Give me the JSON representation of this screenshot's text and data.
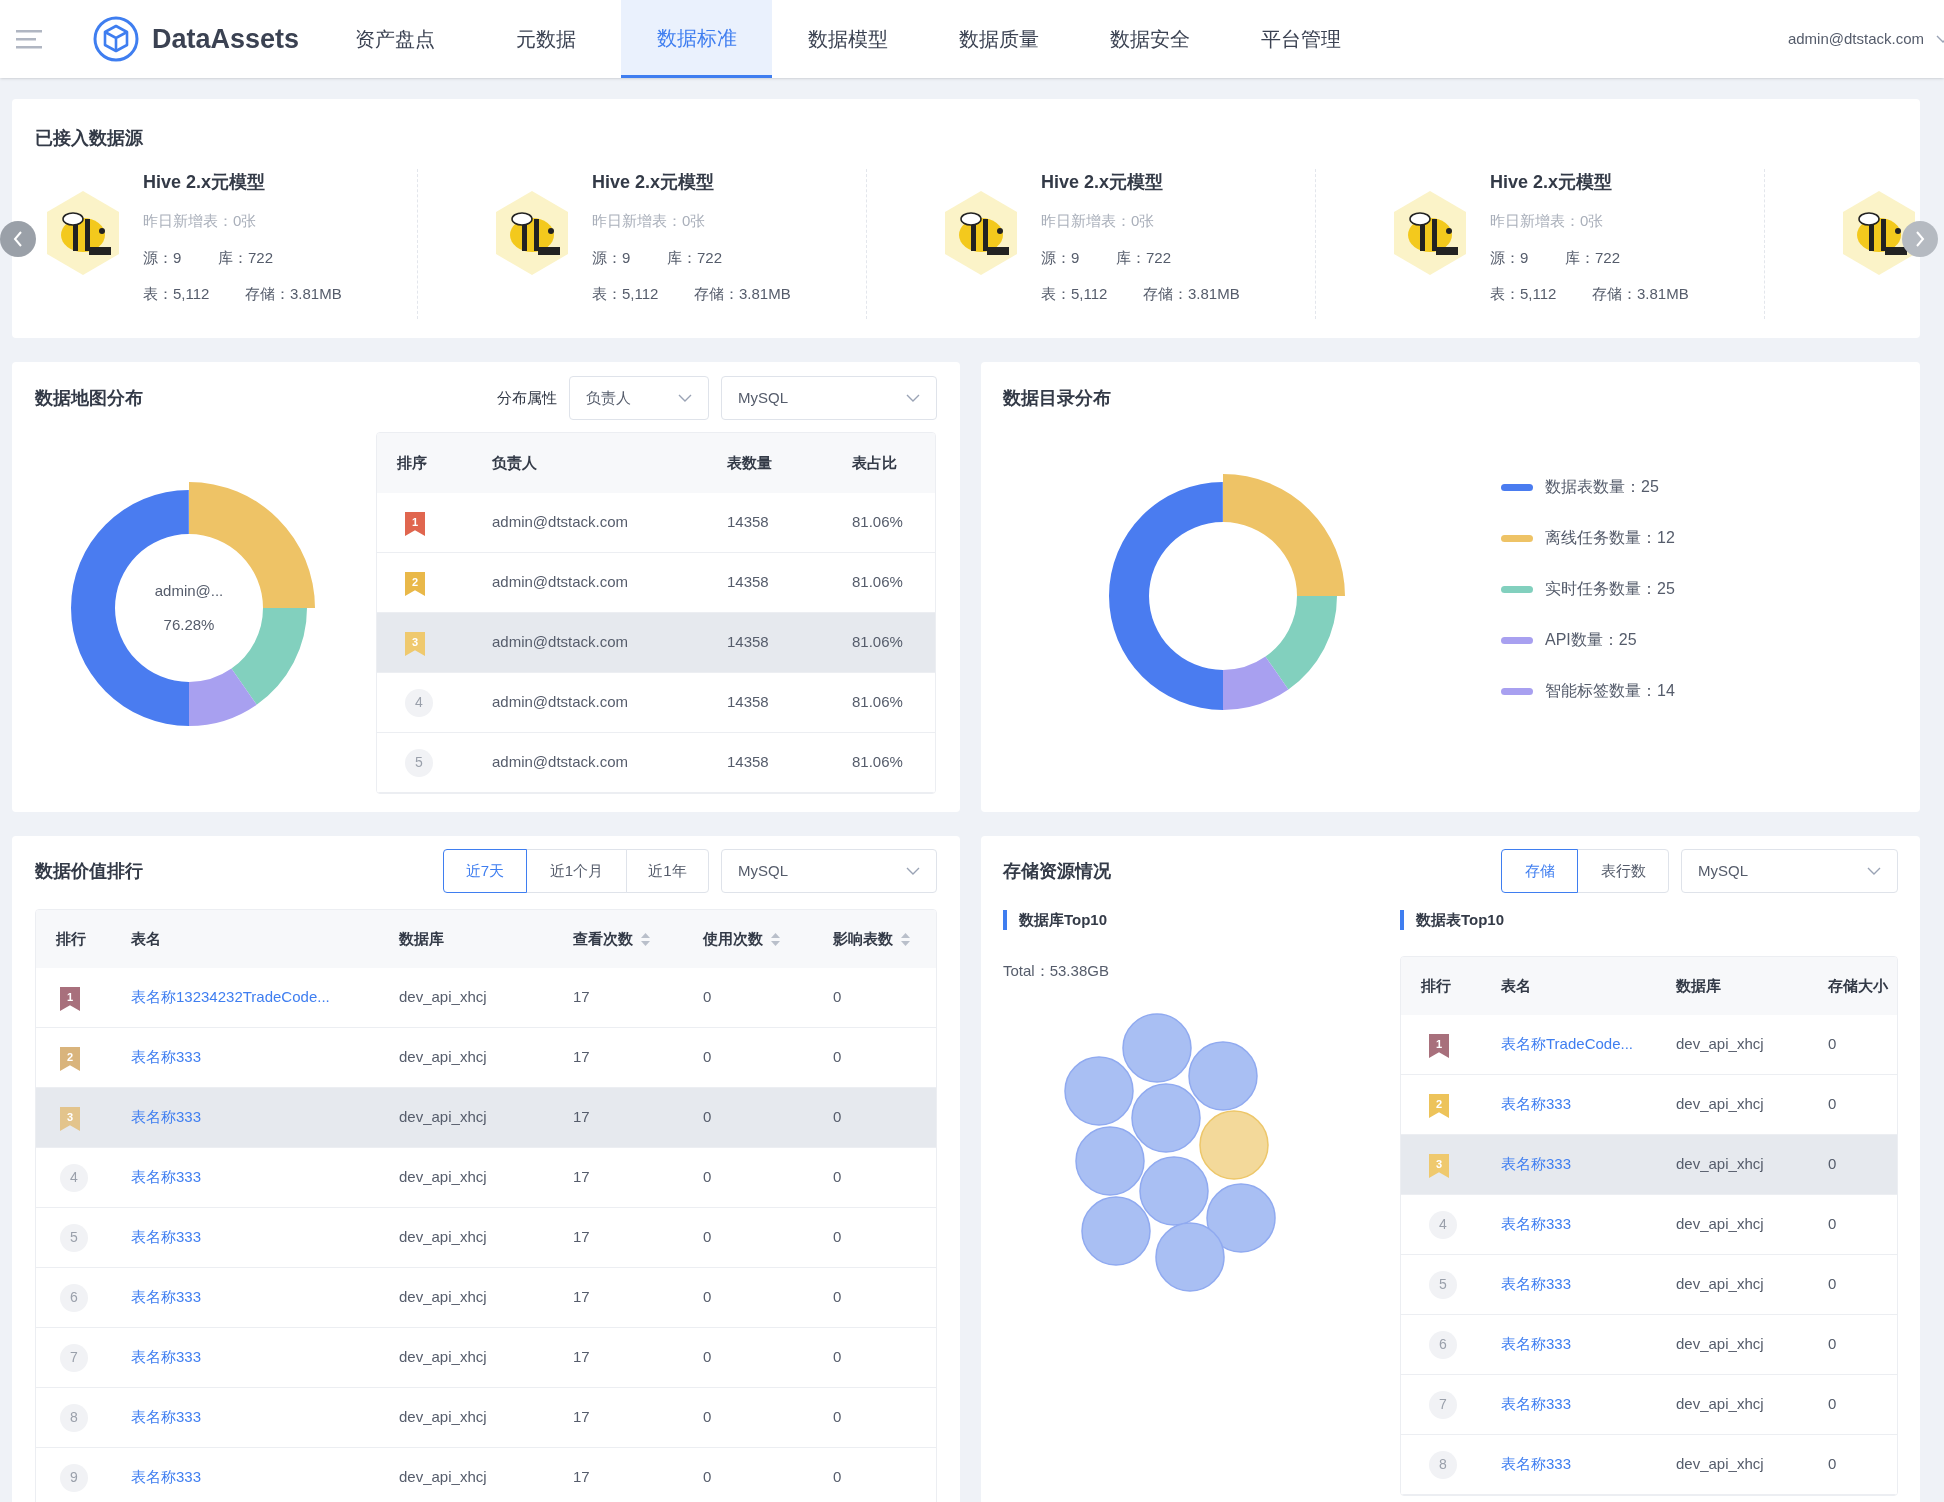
{
  "header": {
    "brand": "DataAssets",
    "nav": [
      {
        "label": "资产盘点",
        "selected": false
      },
      {
        "label": "元数据",
        "selected": false
      },
      {
        "label": "数据标准",
        "selected": true
      },
      {
        "label": "数据模型",
        "selected": false
      },
      {
        "label": "数据质量",
        "selected": false
      },
      {
        "label": "数据安全",
        "selected": false
      },
      {
        "label": "平台管理",
        "selected": false
      }
    ],
    "user": "admin@dtstack.com"
  },
  "sources": {
    "title": "已接入数据源",
    "next_peek": true,
    "items": [
      {
        "name": "Hive 2.x元模型",
        "new_tables": "昨日新增表：0张",
        "sources": "源：9",
        "databases": "库：722",
        "tables": "表：5,112",
        "storage": "存储：3.81MB"
      },
      {
        "name": "Hive 2.x元模型",
        "new_tables": "昨日新增表：0张",
        "sources": "源：9",
        "databases": "库：722",
        "tables": "表：5,112",
        "storage": "存储：3.81MB"
      },
      {
        "name": "Hive 2.x元模型",
        "new_tables": "昨日新增表：0张",
        "sources": "源：9",
        "databases": "库：722",
        "tables": "表：5,112",
        "storage": "存储：3.81MB"
      },
      {
        "name": "Hive 2.x元模型",
        "new_tables": "昨日新增表：0张",
        "sources": "源：9",
        "databases": "库：722",
        "tables": "表：5,112",
        "storage": "存储：3.81MB"
      }
    ]
  },
  "map": {
    "title": "数据地图分布",
    "filter_label": "分布属性",
    "filters": [
      "负责人",
      "MySQL"
    ],
    "donut_label": "admin@...",
    "donut_value": "76.28%",
    "columns": [
      "排序",
      "负责人",
      "表数量",
      "表占比"
    ],
    "rows": [
      {
        "rank": "1",
        "kind": "ribbon",
        "color": "#e0664f",
        "owner": "admin@dtstack.com",
        "count": "14358",
        "share": "81.06%",
        "highlighted": false
      },
      {
        "rank": "2",
        "kind": "ribbon",
        "color": "#e9b849",
        "owner": "admin@dtstack.com",
        "count": "14358",
        "share": "81.06%",
        "highlighted": false
      },
      {
        "rank": "3",
        "kind": "ribbon",
        "color": "#efc96e",
        "owner": "admin@dtstack.com",
        "count": "14358",
        "share": "81.06%",
        "highlighted": true
      },
      {
        "rank": "4",
        "kind": "circle",
        "owner": "admin@dtstack.com",
        "count": "14358",
        "share": "81.06%",
        "highlighted": false
      },
      {
        "rank": "5",
        "kind": "circle",
        "owner": "admin@dtstack.com",
        "count": "14358",
        "share": "81.06%",
        "highlighted": false
      }
    ]
  },
  "catalog": {
    "title": "数据目录分布",
    "legend": [
      {
        "label": "数据表数量：25",
        "color": "#4a7cf0"
      },
      {
        "label": "离线任务数量：12",
        "color": "#eec366"
      },
      {
        "label": "实时任务数量：25",
        "color": "#82d0be"
      },
      {
        "label": "API数量：25",
        "color": "#a8a0f0"
      },
      {
        "label": "智能标签数量：14",
        "color": "#a8a0f0"
      }
    ]
  },
  "value_rank": {
    "title": "数据价值排行",
    "tabs": [
      {
        "label": "近7天",
        "selected": true
      },
      {
        "label": "近1个月",
        "selected": false
      },
      {
        "label": "近1年",
        "selected": false
      }
    ],
    "filter": "MySQL",
    "columns": [
      {
        "label": "排行",
        "sortable": false
      },
      {
        "label": "表名",
        "sortable": false
      },
      {
        "label": "数据库",
        "sortable": false
      },
      {
        "label": "查看次数",
        "sortable": true
      },
      {
        "label": "使用次数",
        "sortable": true
      },
      {
        "label": "影响表数",
        "sortable": true
      }
    ],
    "rows": [
      {
        "rank": "1",
        "kind": "ribbon",
        "color": "#a8707c",
        "name": "表名称13234232TradeCode...",
        "db": "dev_api_xhcj",
        "views": "17",
        "uses": "0",
        "impact": "0",
        "highlighted": false
      },
      {
        "rank": "2",
        "kind": "ribbon",
        "color": "#d9b47c",
        "name": "表名称333",
        "db": "dev_api_xhcj",
        "views": "17",
        "uses": "0",
        "impact": "0",
        "highlighted": false
      },
      {
        "rank": "3",
        "kind": "ribbon",
        "color": "#e3c48c",
        "name": "表名称333",
        "db": "dev_api_xhcj",
        "views": "17",
        "uses": "0",
        "impact": "0",
        "highlighted": true
      },
      {
        "rank": "4",
        "kind": "circle",
        "name": "表名称333",
        "db": "dev_api_xhcj",
        "views": "17",
        "uses": "0",
        "impact": "0",
        "highlighted": false
      },
      {
        "rank": "5",
        "kind": "circle",
        "name": "表名称333",
        "db": "dev_api_xhcj",
        "views": "17",
        "uses": "0",
        "impact": "0",
        "highlighted": false
      },
      {
        "rank": "6",
        "kind": "circle",
        "name": "表名称333",
        "db": "dev_api_xhcj",
        "views": "17",
        "uses": "0",
        "impact": "0",
        "highlighted": false
      },
      {
        "rank": "7",
        "kind": "circle",
        "name": "表名称333",
        "db": "dev_api_xhcj",
        "views": "17",
        "uses": "0",
        "impact": "0",
        "highlighted": false
      },
      {
        "rank": "8",
        "kind": "circle",
        "name": "表名称333",
        "db": "dev_api_xhcj",
        "views": "17",
        "uses": "0",
        "impact": "0",
        "highlighted": false
      },
      {
        "rank": "9",
        "kind": "circle",
        "name": "表名称333",
        "db": "dev_api_xhcj",
        "views": "17",
        "uses": "0",
        "impact": "0",
        "highlighted": false
      }
    ]
  },
  "storage": {
    "title": "存储资源情况",
    "tabs": [
      {
        "label": "存储",
        "selected": true
      },
      {
        "label": "表行数",
        "selected": false
      }
    ],
    "filter": "MySQL",
    "db_title": "数据库Top10",
    "total": "Total：53.38GB",
    "table_title": "数据表Top10",
    "columns": [
      "排行",
      "表名",
      "数据库",
      "存储大小"
    ],
    "rows": [
      {
        "rank": "1",
        "kind": "ribbon",
        "color": "#a8707c",
        "name": "表名称TradeCode...",
        "db": "dev_api_xhcj",
        "size": "0",
        "highlighted": false
      },
      {
        "rank": "2",
        "kind": "ribbon",
        "color": "#edc35a",
        "name": "表名称333",
        "db": "dev_api_xhcj",
        "size": "0",
        "highlighted": false
      },
      {
        "rank": "3",
        "kind": "ribbon",
        "color": "#efc96e",
        "name": "表名称333",
        "db": "dev_api_xhcj",
        "size": "0",
        "highlighted": true
      },
      {
        "rank": "4",
        "kind": "circle",
        "name": "表名称333",
        "db": "dev_api_xhcj",
        "size": "0",
        "highlighted": false
      },
      {
        "rank": "5",
        "kind": "circle",
        "name": "表名称333",
        "db": "dev_api_xhcj",
        "size": "0",
        "highlighted": false
      },
      {
        "rank": "6",
        "kind": "circle",
        "name": "表名称333",
        "db": "dev_api_xhcj",
        "size": "0",
        "highlighted": false
      },
      {
        "rank": "7",
        "kind": "circle",
        "name": "表名称333",
        "db": "dev_api_xhcj",
        "size": "0",
        "highlighted": false
      },
      {
        "rank": "8",
        "kind": "circle",
        "name": "表名称333",
        "db": "dev_api_xhcj",
        "size": "0",
        "highlighted": false
      }
    ]
  }
}
